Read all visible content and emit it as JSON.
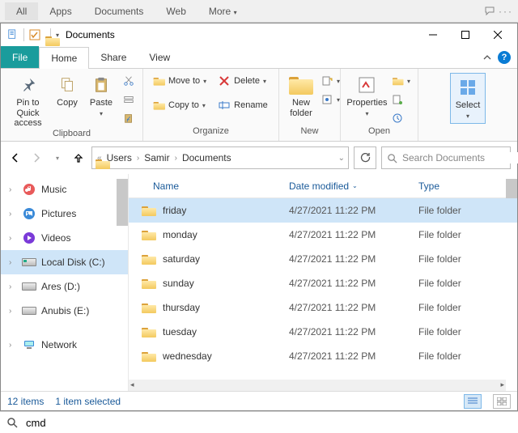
{
  "topbar": {
    "scopes": [
      "All",
      "Apps",
      "Documents",
      "Web",
      "More"
    ],
    "active_index": 0
  },
  "window": {
    "title": "Documents"
  },
  "tabs": {
    "file": "File",
    "home": "Home",
    "share": "Share",
    "view": "View"
  },
  "ribbon": {
    "clipboard": {
      "label": "Clipboard",
      "pin": "Pin to Quick\naccess",
      "copy": "Copy",
      "paste": "Paste"
    },
    "organize": {
      "label": "Organize",
      "move_to": "Move to",
      "copy_to": "Copy to",
      "delete": "Delete",
      "rename": "Rename"
    },
    "new": {
      "label": "New",
      "new_folder": "New\nfolder"
    },
    "open": {
      "label": "Open",
      "properties": "Properties"
    },
    "select": {
      "select": "Select"
    }
  },
  "breadcrumb": {
    "items": [
      "Users",
      "Samir",
      "Documents"
    ]
  },
  "search": {
    "placeholder": "Search Documents"
  },
  "sidebar": {
    "items": [
      {
        "label": "Music",
        "kind": "music"
      },
      {
        "label": "Pictures",
        "kind": "pictures"
      },
      {
        "label": "Videos",
        "kind": "videos"
      },
      {
        "label": "Local Disk (C:)",
        "kind": "drive-c",
        "selected": true
      },
      {
        "label": "Ares (D:)",
        "kind": "drive"
      },
      {
        "label": "Anubis (E:)",
        "kind": "drive"
      },
      {
        "label": "Network",
        "kind": "network",
        "gap": true
      }
    ]
  },
  "columns": {
    "name": "Name",
    "date": "Date modified",
    "type": "Type"
  },
  "files": [
    {
      "name": "friday",
      "date": "4/27/2021 11:22 PM",
      "type": "File folder",
      "selected": true
    },
    {
      "name": "monday",
      "date": "4/27/2021 11:22 PM",
      "type": "File folder"
    },
    {
      "name": "saturday",
      "date": "4/27/2021 11:22 PM",
      "type": "File folder"
    },
    {
      "name": "sunday",
      "date": "4/27/2021 11:22 PM",
      "type": "File folder"
    },
    {
      "name": "thursday",
      "date": "4/27/2021 11:22 PM",
      "type": "File folder"
    },
    {
      "name": "tuesday",
      "date": "4/27/2021 11:22 PM",
      "type": "File folder"
    },
    {
      "name": "wednesday",
      "date": "4/27/2021 11:22 PM",
      "type": "File folder"
    }
  ],
  "status": {
    "items_count": "12 items",
    "selection": "1 item selected"
  },
  "bottom_search": {
    "value": "cmd"
  }
}
